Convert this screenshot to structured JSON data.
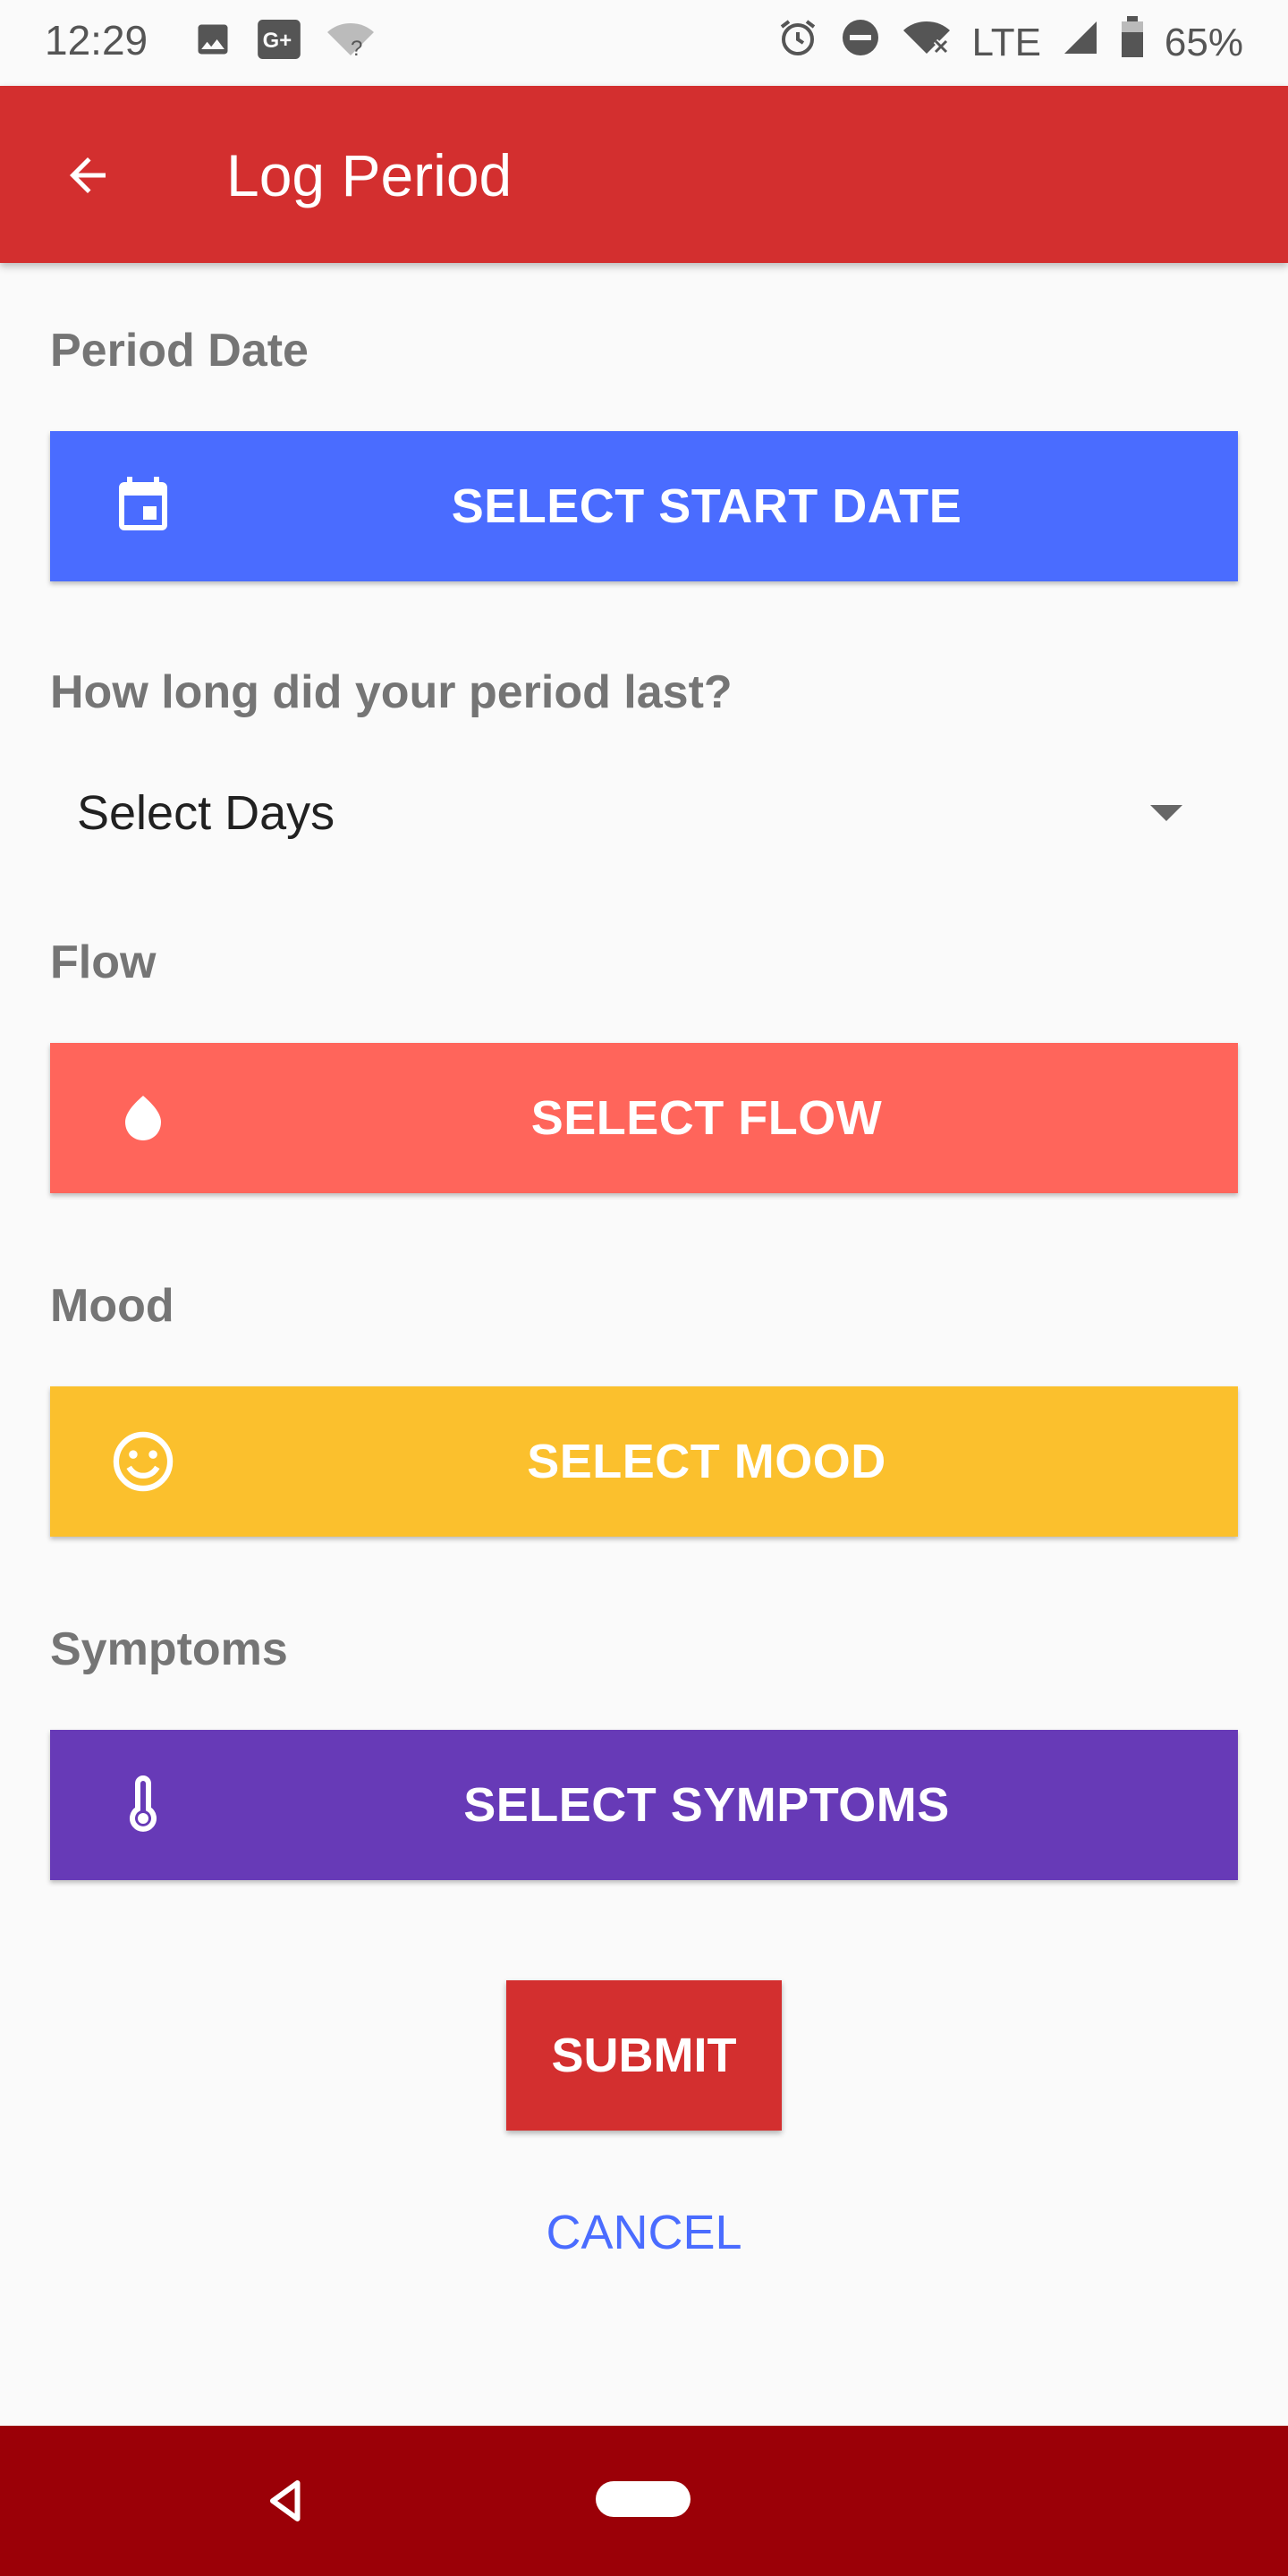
{
  "status_bar": {
    "time": "12:29",
    "network": "LTE",
    "battery": "65%",
    "icons": [
      "image-icon",
      "google-plus-icon",
      "wifi-unknown-icon",
      "alarm-icon",
      "do-not-disturb-icon",
      "wifi-off-icon",
      "signal-icon",
      "battery-icon"
    ]
  },
  "app_bar": {
    "title": "Log Period",
    "color": "#d32f2f"
  },
  "form": {
    "period_date_label": "Period Date",
    "select_start_date": "SELECT START DATE",
    "duration_label": "How long did your period last?",
    "select_days": "Select Days",
    "flow_label": "Flow",
    "select_flow": "SELECT FLOW",
    "mood_label": "Mood",
    "select_mood": "SELECT MOOD",
    "symptoms_label": "Symptoms",
    "select_symptoms": "SELECT SYMPTOMS"
  },
  "actions": {
    "submit": "SUBMIT",
    "cancel": "CANCEL"
  },
  "colors": {
    "date_button": "#4a6cff",
    "flow_button": "#ff655b",
    "mood_button": "#fbc02d",
    "symptoms_button": "#673ab7",
    "nav_bar": "#9b0007"
  }
}
